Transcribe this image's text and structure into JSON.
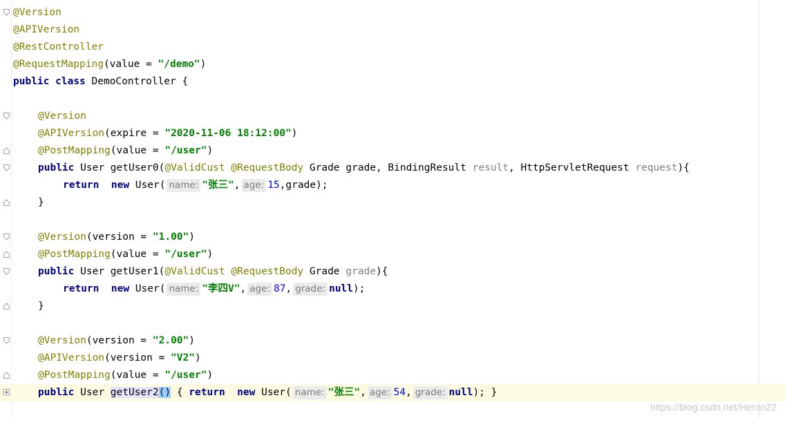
{
  "code": {
    "l1_ann": "@Version",
    "l2_ann": "@APIVersion",
    "l3_ann": "@RestController",
    "l4_ann": "@RequestMapping",
    "l4_a": "(value = ",
    "l4_str": "\"/demo\"",
    "l4_b": ")",
    "l5_kw1": "public",
    "l5_kw2": "class",
    "l5_txt": "DemoController {",
    "l7_ann": "@Version",
    "l8_ann": "@APIVersion",
    "l8_a": "(expire = ",
    "l8_str": "\"2020-11-06 18:12:00\"",
    "l8_b": ")",
    "l9_ann": "@PostMapping",
    "l9_a": "(value = ",
    "l9_str": "\"/user\"",
    "l9_b": ")",
    "l10_kw": "public",
    "l10_a": "User getUser0(",
    "l10_ann1": "@ValidCust",
    "l10_ann2": "@RequestBody",
    "l10_b": "Grade grade, BindingResult",
    "l10_p1": "result",
    "l10_c": ", HttpServletRequest",
    "l10_p2": "request",
    "l10_d": "){",
    "l11_kw1": "return",
    "l11_kw2": "new",
    "l11_a": "User(",
    "l11_h1": "name:",
    "l11_str": "\"张三\"",
    "l11_c1": ",",
    "l11_h2": "age:",
    "l11_num": "15",
    "l11_b": ",grade);",
    "l12": "}",
    "l14_ann": "@Version",
    "l14_a": "(version = ",
    "l14_str": "\"1.00\"",
    "l14_b": ")",
    "l15_ann": "@PostMapping",
    "l15_a": "(value = ",
    "l15_str": "\"/user\"",
    "l15_b": ")",
    "l16_kw": "public",
    "l16_a": "User getUser1(",
    "l16_ann1": "@ValidCust",
    "l16_ann2": "@RequestBody",
    "l16_b": "Grade",
    "l16_p": "grade",
    "l16_c": "){",
    "l17_kw1": "return",
    "l17_kw2": "new",
    "l17_a": "User(",
    "l17_h1": "name:",
    "l17_str": "\"李四V\"",
    "l17_c1": ",",
    "l17_h2": "age:",
    "l17_num": "87",
    "l17_c2": ",",
    "l17_h3": "grade:",
    "l17_kw3": "null",
    "l17_b": ");",
    "l18": "}",
    "l20_ann": "@Version",
    "l20_a": "(version = ",
    "l20_str": "\"2.00\"",
    "l20_b": ")",
    "l21_ann": "@APIVersion",
    "l21_a": "(version = ",
    "l21_str": "\"V2\"",
    "l21_b": ")",
    "l22_ann": "@PostMapping",
    "l22_a": "(value = ",
    "l22_str": "\"/user\"",
    "l22_b": ")",
    "l23_kw": "public",
    "l23_a": "User",
    "l23_method": "getUser2",
    "l23_paren": "()",
    "l23_brace1": " { ",
    "l23_kw1": "return",
    "l23_kw2": "new",
    "l23_b": "User(",
    "l23_h1": "name:",
    "l23_str": "\"张三\"",
    "l23_c1": ",",
    "l23_h2": "age:",
    "l23_num": "54",
    "l23_c2": ",",
    "l23_h3": "grade:",
    "l23_kw3": "null",
    "l23_c": "); ",
    "l23_brace2": "}"
  },
  "watermark": "https://blog.csdn.net/Heron22",
  "colors": {
    "annotation": "#808000",
    "keyword": "#000080",
    "string": "#008000",
    "number": "#0000ff",
    "current_line": "#fcfae1"
  }
}
